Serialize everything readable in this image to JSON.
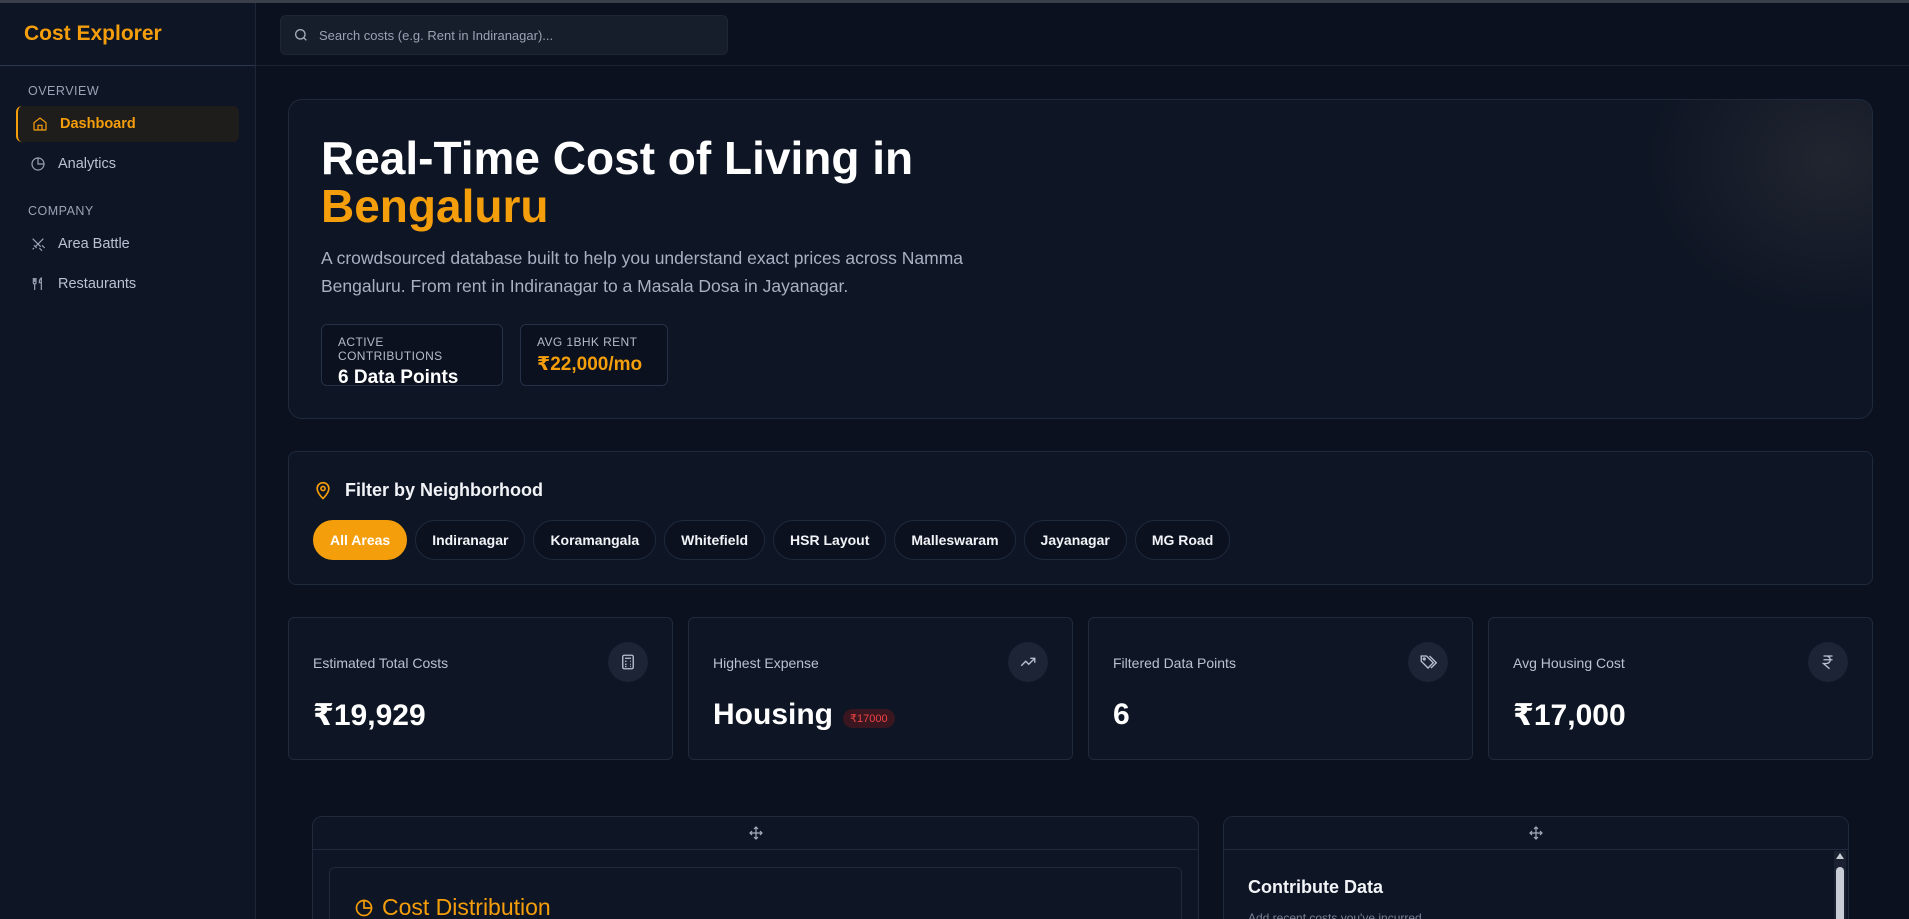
{
  "brand": {
    "title": "Cost Explorer"
  },
  "sidebar": {
    "sections": [
      {
        "label": "OVERVIEW",
        "items": [
          {
            "label": "Dashboard",
            "icon": "home-icon",
            "active": true
          },
          {
            "label": "Analytics",
            "icon": "pie-chart-icon",
            "active": false
          }
        ]
      },
      {
        "label": "COMPANY",
        "items": [
          {
            "label": "Area Battle",
            "icon": "crossed-swords-icon",
            "active": false
          },
          {
            "label": "Restaurants",
            "icon": "utensils-icon",
            "active": false
          }
        ]
      }
    ]
  },
  "search": {
    "placeholder": "Search costs (e.g. Rent in Indiranagar)..."
  },
  "hero": {
    "title_line1": "Real-Time Cost of Living in",
    "title_accent": "Bengaluru",
    "description": "A crowdsourced database built to help you understand exact prices across Namma Bengaluru. From rent in Indiranagar to a Masala Dosa in Jayanagar.",
    "stats": [
      {
        "label": "Active Contributions",
        "value": "6 Data Points"
      },
      {
        "label": "Avg 1BHK Rent",
        "value": "₹22,000/mo"
      }
    ]
  },
  "filter": {
    "title": "Filter by Neighborhood",
    "options": [
      "All Areas",
      "Indiranagar",
      "Koramangala",
      "Whitefield",
      "HSR Layout",
      "Malleswaram",
      "Jayanagar",
      "MG Road"
    ],
    "selected": "All Areas"
  },
  "metrics": [
    {
      "label": "Estimated Total Costs",
      "value": "₹19,929",
      "icon": "calculator-icon"
    },
    {
      "label": "Highest Expense",
      "value": "Housing",
      "badge": "₹17000",
      "icon": "trending-up-icon"
    },
    {
      "label": "Filtered Data Points",
      "value": "6",
      "icon": "tags-icon"
    },
    {
      "label": "Avg Housing Cost",
      "value": "₹17,000",
      "icon": "rupee-icon"
    }
  ],
  "panels": {
    "distribution": {
      "title": "Cost Distribution"
    },
    "contribute": {
      "title": "Contribute Data",
      "subtitle": "Add recent costs you've incurred."
    }
  },
  "colors": {
    "accent": "#f59e0b",
    "background": "#0b111e",
    "surface": "#0e1524",
    "danger": "#ef4444"
  }
}
